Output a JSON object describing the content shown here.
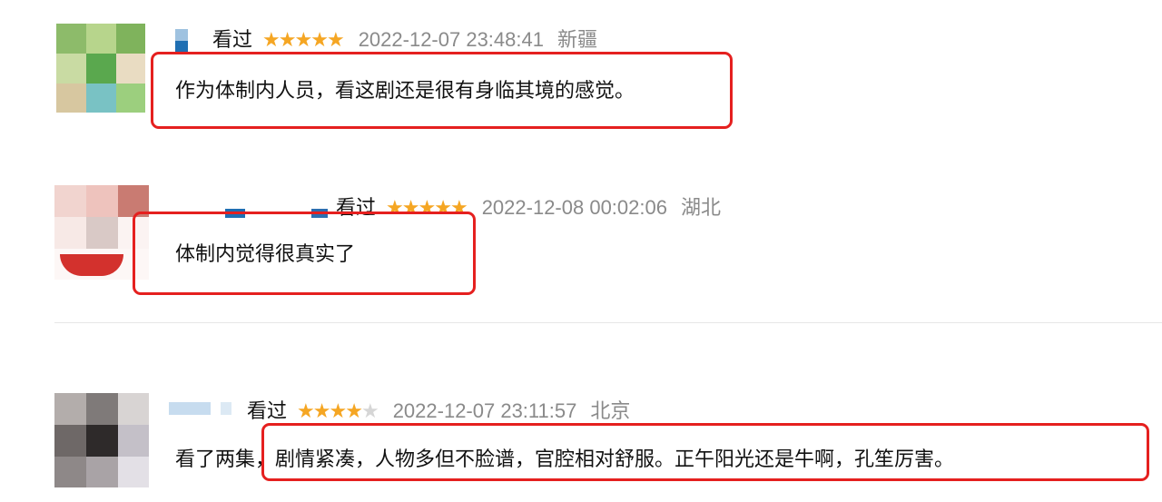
{
  "reviews": [
    {
      "status": "看过",
      "rating": 5,
      "date": "2022-12-07 23:48:41",
      "location": "新疆",
      "comment": "作为体制内人员，看这剧还是很有身临其境的感觉。",
      "highlighted": true
    },
    {
      "status": "看过",
      "rating": 5,
      "date": "2022-12-08 00:02:06",
      "location": "湖北",
      "comment": "体制内觉得很真实了",
      "highlighted": true
    },
    {
      "status": "看过",
      "rating": 4,
      "date": "2022-12-07 23:11:57",
      "location": "北京",
      "comment": "看了两集，剧情紧凑，人物多但不脸谱，官腔相对舒服。正午阳光还是牛啊，孔笙厉害。",
      "highlighted": true
    }
  ],
  "colors": {
    "star_on": "#f5a623",
    "star_off": "#d6d6d6",
    "highlight_border": "#e5201f",
    "meta_text": "#8a8a8a"
  },
  "icons": {
    "star": "star-icon"
  }
}
